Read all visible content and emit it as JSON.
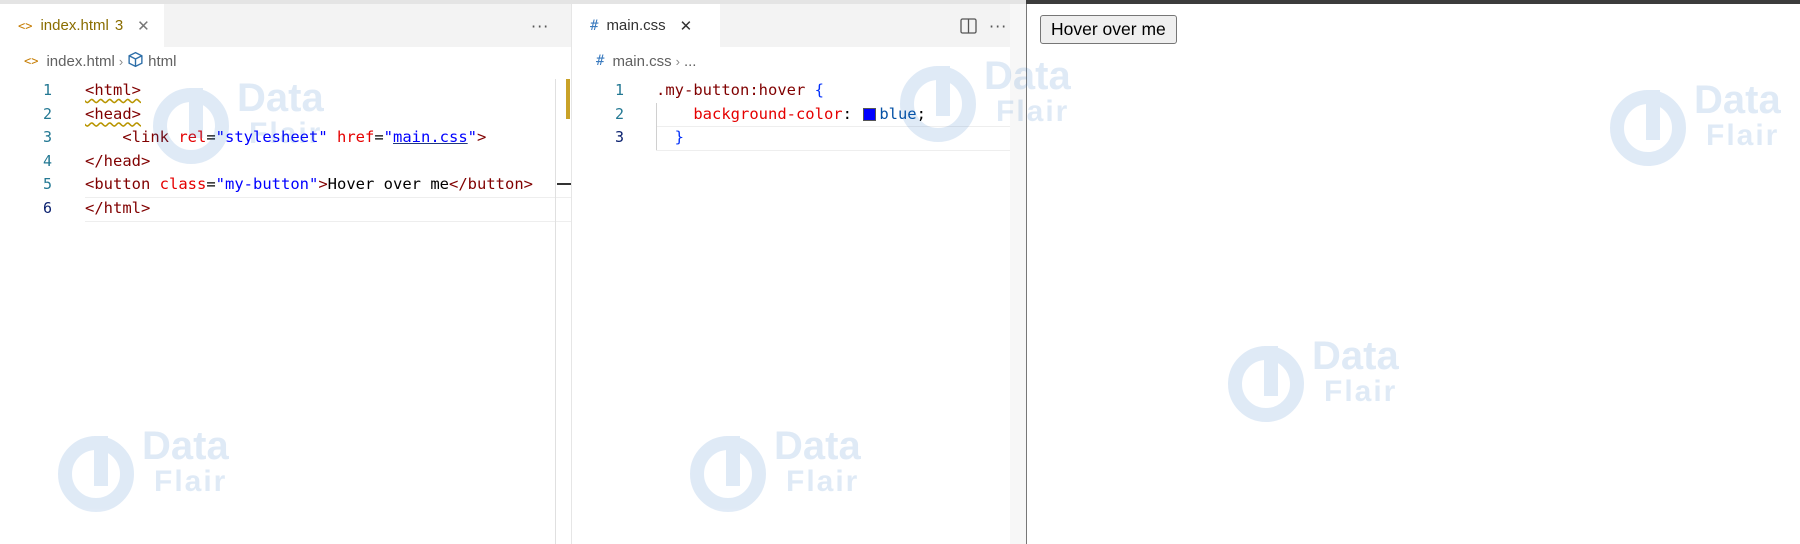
{
  "editor_left": {
    "tab": {
      "icon": "<>",
      "label": "index.html",
      "problem_count": "3",
      "close": "✕"
    },
    "more_actions": "···",
    "breadcrumb": {
      "file_icon": "<>",
      "file": "index.html",
      "symbol": "html"
    },
    "lines": [
      {
        "num": "1",
        "parts": [
          {
            "t": "<html>",
            "c": "tag squig"
          }
        ]
      },
      {
        "num": "2",
        "parts": [
          {
            "t": "<head>",
            "c": "tag squig"
          }
        ]
      },
      {
        "num": "3",
        "parts": [
          {
            "t": "    <link ",
            "c": "tag"
          },
          {
            "t": "rel",
            "c": "attr"
          },
          {
            "t": "=",
            "c": "plain"
          },
          {
            "t": "\"stylesheet\"",
            "c": "str"
          },
          {
            "t": " ",
            "c": "plain"
          },
          {
            "t": "href",
            "c": "attr"
          },
          {
            "t": "=",
            "c": "plain"
          },
          {
            "t": "\"",
            "c": "str"
          },
          {
            "t": "main.css",
            "c": "str link-u"
          },
          {
            "t": "\"",
            "c": "str"
          },
          {
            "t": ">",
            "c": "tag"
          }
        ]
      },
      {
        "num": "4",
        "parts": [
          {
            "t": "</head>",
            "c": "tag"
          }
        ]
      },
      {
        "num": "5",
        "parts": [
          {
            "t": "<button ",
            "c": "tag"
          },
          {
            "t": "class",
            "c": "attr"
          },
          {
            "t": "=",
            "c": "plain"
          },
          {
            "t": "\"my-button\"",
            "c": "str"
          },
          {
            "t": ">",
            "c": "tag"
          },
          {
            "t": "Hover over me",
            "c": "plain"
          },
          {
            "t": "</button>",
            "c": "tag"
          }
        ]
      },
      {
        "num": "6",
        "parts": [
          {
            "t": "</html>",
            "c": "tag"
          }
        ]
      }
    ],
    "active_line": "6"
  },
  "editor_right": {
    "tab": {
      "icon": "#",
      "label": "main.css",
      "close": "✕"
    },
    "split_icon": "split-editor-icon",
    "more_actions": "···",
    "breadcrumb": {
      "file_icon": "#",
      "file": "main.css",
      "symbol": "..."
    },
    "lines": [
      {
        "num": "1",
        "parts": [
          {
            "t": ".my-button:hover",
            "c": "sel"
          },
          {
            "t": " ",
            "c": "plain"
          },
          {
            "t": "{",
            "c": "brace"
          }
        ]
      },
      {
        "num": "2",
        "parts": [
          {
            "t": "    ",
            "c": "plain"
          },
          {
            "t": "background-color",
            "c": "prop"
          },
          {
            "t": ": ",
            "c": "plain"
          },
          {
            "t": "SWATCH",
            "c": "swatch"
          },
          {
            "t": "blue",
            "c": "val"
          },
          {
            "t": ";",
            "c": "plain"
          }
        ]
      },
      {
        "num": "3",
        "parts": [
          {
            "t": "  ",
            "c": "plain"
          },
          {
            "t": "}",
            "c": "brace"
          }
        ]
      }
    ],
    "active_line": "3",
    "swatch_color": "#0000ff"
  },
  "browser": {
    "button_label": "Hover over me"
  },
  "colors": {
    "tab_active_text_html": "#8a6d00",
    "tab_active_text_css": "#333333",
    "line_number": "#237893"
  }
}
